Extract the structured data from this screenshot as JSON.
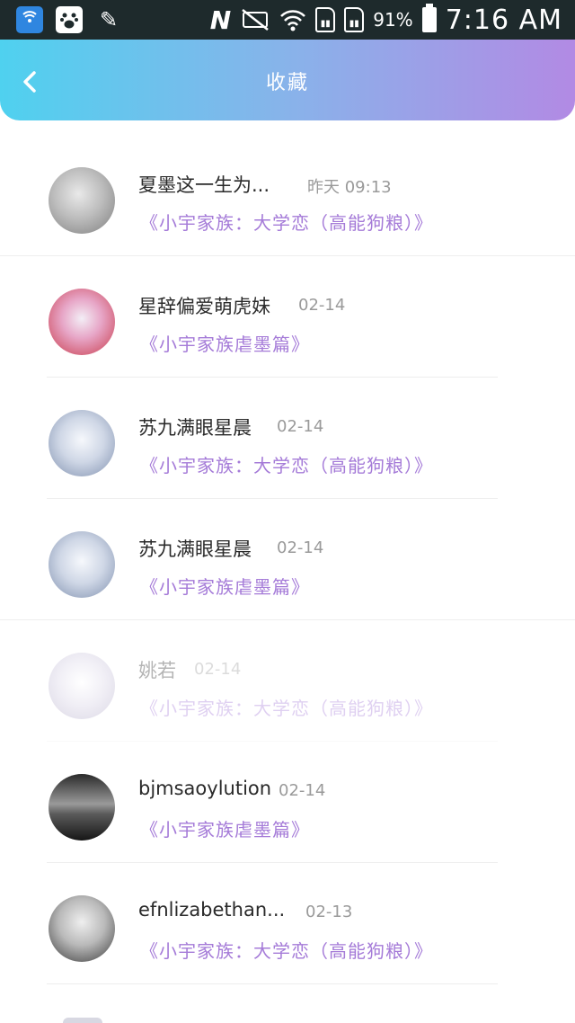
{
  "status_bar": {
    "battery_percent": "91%",
    "time": "7:16 AM",
    "left_icons": [
      "wifi-key-app-icon",
      "baidu-icon",
      "pen-icon"
    ],
    "right_icons": [
      "nfc-icon",
      "mute-icon",
      "wifi-icon",
      "sim1-icon",
      "sim2-icon",
      "battery-icon"
    ]
  },
  "header": {
    "title": "收藏",
    "back_icon": "chevron-left-icon",
    "gradient": [
      "#4fd1ef",
      "#b28ae4"
    ]
  },
  "items": [
    {
      "name": "夏墨这一生为...",
      "time": "昨天 09:13",
      "book": "《小宇家族：大学恋（高能狗粮）》",
      "avatar_color": [
        "#cfcfcf",
        "#7d7d7d"
      ]
    },
    {
      "name": "星辞偏爱萌虎妹",
      "time": "02-14",
      "book": "《小宇家族虐墨篇》",
      "avatar_color": [
        "#e7a6c7",
        "#c83a4a"
      ]
    },
    {
      "name": "苏九满眼星晨",
      "time": "02-14",
      "book": "《小宇家族：大学恋（高能狗粮）》",
      "avatar_color": [
        "#dfe6f2",
        "#7e8fae"
      ]
    },
    {
      "name": "苏九满眼星晨",
      "time": "02-14",
      "book": "《小宇家族虐墨篇》",
      "avatar_color": [
        "#dfe6f2",
        "#7e8fae"
      ]
    },
    {
      "name": "姚若",
      "time": "02-14",
      "book": "《小宇家族：大学恋（高能狗粮）》",
      "avatar_color": [
        "#eeeaf5",
        "#b7b0cc"
      ]
    },
    {
      "name": "bjmsaoylution",
      "time": "02-14",
      "book": "《小宇家族虐墨篇》",
      "avatar_color": [
        "#6b6b6b",
        "#1a1a1a"
      ]
    },
    {
      "name": "efnlizabethan...",
      "time": "02-13",
      "book": "《小宇家族：大学恋（高能狗粮）》",
      "avatar_color": [
        "#d0d0d0",
        "#3a3a3a"
      ]
    }
  ],
  "colors": {
    "book_title": "#a57bd8",
    "time_text": "#9a9a9a",
    "name_text": "#2a2a2a"
  }
}
